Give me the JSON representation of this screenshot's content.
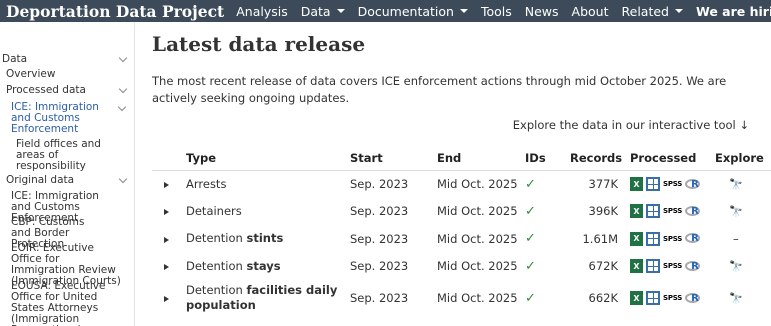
{
  "navbar": {
    "brand": "Deportation Data Project",
    "items": [
      {
        "label": "Analysis",
        "dropdown": false,
        "bold": false
      },
      {
        "label": "Data",
        "dropdown": true,
        "bold": false
      },
      {
        "label": "Documentation",
        "dropdown": true,
        "bold": false
      },
      {
        "label": "Tools",
        "dropdown": false,
        "bold": false
      },
      {
        "label": "News",
        "dropdown": false,
        "bold": false
      },
      {
        "label": "About",
        "dropdown": false,
        "bold": false
      },
      {
        "label": "Related",
        "dropdown": true,
        "bold": false
      },
      {
        "label": "We are hiring!",
        "dropdown": false,
        "bold": true
      }
    ]
  },
  "sidebar": {
    "items": [
      {
        "label": "Data"
      },
      {
        "label": "Overview"
      },
      {
        "label": "Processed data"
      },
      {
        "label": "ICE: Immigration and Customs Enforcement",
        "active": true
      },
      {
        "label": "Field offices and areas of responsibility"
      },
      {
        "label": "Original data"
      },
      {
        "label": "ICE: Immigration and Customs Enforcement"
      },
      {
        "label": "CBP: Customs and Border Protection"
      },
      {
        "label": "EOIR: Executive Office for Immigration Review (Immigration Courts)"
      },
      {
        "label": "EOUSA: Executive Office for United States Attorneys (Immigration Prosecutions)"
      }
    ]
  },
  "main": {
    "title": "Latest data release",
    "intro": "The most recent release of data covers ICE enforcement actions through mid October 2025. We are actively seeking ongoing updates.",
    "explore_link": "Explore the data in our interactive tool ↓",
    "table": {
      "headers": [
        "Type",
        "Start",
        "End",
        "IDs",
        "Records",
        "Processed",
        "Explore"
      ],
      "rows": [
        {
          "type_plain": "Arrests",
          "type_bold": "",
          "start": "Sep. 2023",
          "end": "Mid Oct. 2025",
          "records": "377K",
          "explore": true
        },
        {
          "type_plain": "Detainers",
          "type_bold": "",
          "start": "Sep. 2023",
          "end": "Mid Oct. 2025",
          "records": "396K",
          "explore": true
        },
        {
          "type_plain": "Detention ",
          "type_bold": "stints",
          "start": "Sep. 2023",
          "end": "Mid Oct. 2025",
          "records": "1.61M",
          "explore": false
        },
        {
          "type_plain": "Detention ",
          "type_bold": "stays",
          "start": "Sep. 2023",
          "end": "Mid Oct. 2025",
          "records": "672K",
          "explore": true
        },
        {
          "type_plain": "Detention ",
          "type_bold": "facilities daily population",
          "start": "Sep. 2023",
          "end": "Mid Oct. 2025",
          "records": "662K",
          "explore": true
        }
      ],
      "ids_symbol": "✓",
      "excel_letter": "X",
      "spss_text": "SPSS",
      "r_letter": "R",
      "no_explore": "–"
    },
    "colors": {
      "navbar": "#3c4a5a",
      "link": "#2a5ea8",
      "check": "#2e8b3a"
    }
  }
}
